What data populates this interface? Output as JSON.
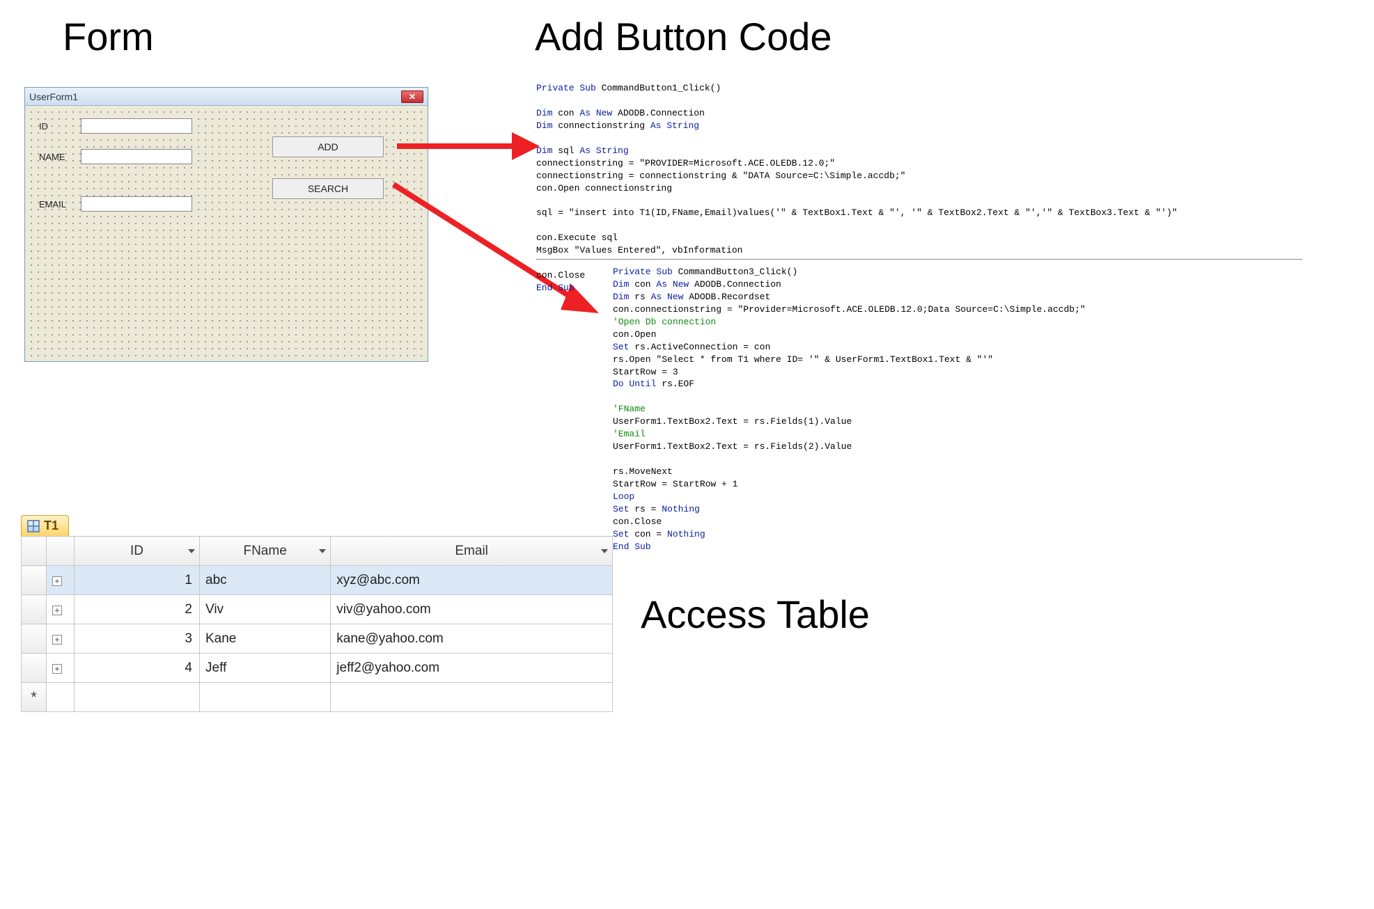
{
  "headings": {
    "form": "Form",
    "add_button_code": "Add Button Code",
    "access_table": "Access Table"
  },
  "userform": {
    "title": "UserForm1",
    "close_glyph": "✕",
    "labels": {
      "id": "ID",
      "name": "NAME",
      "email": "EMAIL"
    },
    "buttons": {
      "add": "ADD",
      "search": "SEARCH"
    }
  },
  "code1": {
    "l1a": "Private Sub",
    "l1b": " CommandButton1_Click()",
    "l3a": "Dim",
    "l3b": " con ",
    "l3c": "As New",
    "l3d": " ADODB.Connection",
    "l4a": "Dim",
    "l4b": " connectionstring ",
    "l4c": "As String",
    "l6a": "Dim",
    "l6b": " sql ",
    "l6c": "As String",
    "l7": "connectionstring = \"PROVIDER=Microsoft.ACE.OLEDB.12.0;\"",
    "l8": "connectionstring = connectionstring & \"DATA Source=C:\\Simple.accdb;\"",
    "l9": "con.Open connectionstring",
    "l11": "sql = \"insert into T1(ID,FName,Email)values('\" & TextBox1.Text & \"', '\" & TextBox2.Text & \"','\" & TextBox3.Text & \"')\"",
    "l13": "con.Execute sql",
    "l14": "MsgBox \"Values Entered\", vbInformation",
    "l16": "con.Close",
    "l17": "End Sub"
  },
  "code2": {
    "l1a": "Private Sub",
    "l1b": " CommandButton3_Click()",
    "l2a": "Dim",
    "l2b": " con ",
    "l2c": "As New",
    "l2d": " ADODB.Connection",
    "l3a": "Dim",
    "l3b": " rs ",
    "l3c": "As New",
    "l3d": " ADODB.Recordset",
    "l4": "con.connectionstring = \"Provider=Microsoft.ACE.OLEDB.12.0;Data Source=C:\\Simple.accdb;\"",
    "l5": "'Open Db connection",
    "l6": "con.Open",
    "l7a": "Set",
    "l7b": " rs.ActiveConnection = con",
    "l8": "rs.Open \"Select * from T1 where ID= '\" & UserForm1.TextBox1.Text & \"'\"",
    "l9": "StartRow = 3",
    "l10a": "Do Until",
    "l10b": " rs.EOF",
    "l12": "'FName",
    "l13": "UserForm1.TextBox2.Text = rs.Fields(1).Value",
    "l14": "'Email",
    "l15": "UserForm1.TextBox2.Text = rs.Fields(2).Value",
    "l17": "rs.MoveNext",
    "l18": "StartRow = StartRow + 1",
    "l19": "Loop",
    "l20a": "Set",
    "l20b": " rs = ",
    "l20c": "Nothing",
    "l21": "con.Close",
    "l22a": "Set",
    "l22b": " con = ",
    "l22c": "Nothing",
    "l23": "End Sub"
  },
  "table": {
    "tab": "T1",
    "columns": [
      "ID",
      "FName",
      "Email"
    ],
    "rows": [
      {
        "id": "1",
        "fname": "abc",
        "email": "xyz@abc.com"
      },
      {
        "id": "2",
        "fname": "Viv",
        "email": "viv@yahoo.com"
      },
      {
        "id": "3",
        "fname": "Kane",
        "email": "kane@yahoo.com"
      },
      {
        "id": "4",
        "fname": "Jeff",
        "email": "jeff2@yahoo.com"
      }
    ],
    "expand_glyph": "+",
    "newrow_glyph": "*"
  }
}
